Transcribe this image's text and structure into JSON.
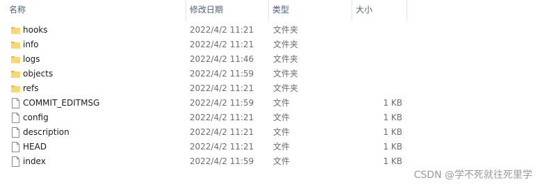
{
  "columns": {
    "name": "名称",
    "date": "修改日期",
    "type": "类型",
    "size": "大小"
  },
  "sort_icon": "sort-ascending-arrow",
  "files": [
    {
      "name": "hooks",
      "date": "2022/4/2 11:21",
      "type": "文件夹",
      "size": "",
      "icon": "folder-icon"
    },
    {
      "name": "info",
      "date": "2022/4/2 11:21",
      "type": "文件夹",
      "size": "",
      "icon": "folder-icon"
    },
    {
      "name": "logs",
      "date": "2022/4/2 11:46",
      "type": "文件夹",
      "size": "",
      "icon": "folder-icon"
    },
    {
      "name": "objects",
      "date": "2022/4/2 11:59",
      "type": "文件夹",
      "size": "",
      "icon": "folder-icon"
    },
    {
      "name": "refs",
      "date": "2022/4/2 11:21",
      "type": "文件夹",
      "size": "",
      "icon": "folder-icon"
    },
    {
      "name": "COMMIT_EDITMSG",
      "date": "2022/4/2 11:59",
      "type": "文件",
      "size": "1 KB",
      "icon": "file-icon"
    },
    {
      "name": "config",
      "date": "2022/4/2 11:21",
      "type": "文件",
      "size": "1 KB",
      "icon": "file-icon"
    },
    {
      "name": "description",
      "date": "2022/4/2 11:21",
      "type": "文件",
      "size": "1 KB",
      "icon": "file-icon"
    },
    {
      "name": "HEAD",
      "date": "2022/4/2 11:21",
      "type": "文件",
      "size": "1 KB",
      "icon": "file-icon"
    },
    {
      "name": "index",
      "date": "2022/4/2 11:59",
      "type": "文件",
      "size": "1 KB",
      "icon": "file-icon"
    }
  ],
  "watermark": "CSDN @学不死就往死里学",
  "colors": {
    "folder": "#f8d775",
    "folder_dark": "#e6b84a",
    "header_text": "#4c607a",
    "meta_text": "#6d6d6d"
  }
}
